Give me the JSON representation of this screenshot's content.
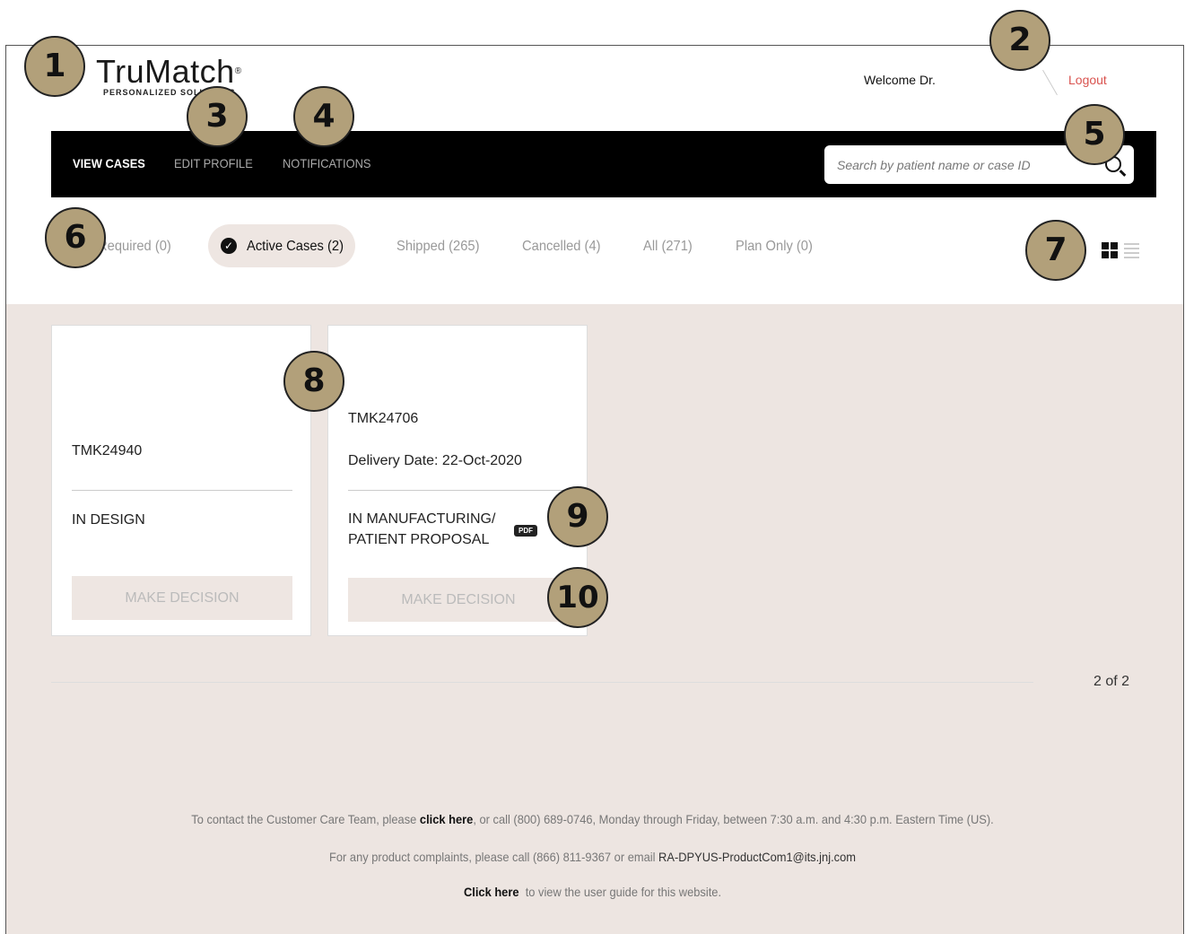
{
  "header": {
    "logo_word": "TruMatch",
    "logo_tag": "PERSONALIZED SOLUTIONS",
    "welcome": "Welcome Dr.",
    "logout": "Logout"
  },
  "nav": {
    "items": [
      "VIEW CASES",
      "EDIT PROFILE",
      "NOTIFICATIONS"
    ],
    "search_placeholder": "Search by patient name or case ID"
  },
  "filters": {
    "action_required": "Action Required (0)",
    "active": "Active Cases (2)",
    "shipped": "Shipped (265)",
    "cancelled": "Cancelled (4)",
    "all": "All (271)",
    "plan_only": "Plan Only (0)"
  },
  "cards": [
    {
      "case_id": "TMK24940",
      "status": "IN DESIGN",
      "button": "MAKE DECISION"
    },
    {
      "case_id": "TMK24706",
      "delivery": "Delivery Date: 22-Oct-2020",
      "status_line1": "IN MANUFACTURING/",
      "status_line2": "PATIENT PROPOSAL",
      "pdf": "PDF",
      "button": "MAKE DECISION"
    }
  ],
  "pager": "2 of 2",
  "footer": {
    "line1_pre": "To contact the Customer Care Team, please ",
    "line1_link": "click here",
    "line1_post": ", or call (800) 689-0746, Monday through Friday, between 7:30 a.m. and 4:30 p.m. Eastern Time (US).",
    "line2_pre": "For any product complaints, please call (866) 811-9367 or email ",
    "line2_email": "RA-DPYUS-ProductCom1@its.jnj.com",
    "line3_link": "Click here",
    "line3_post": "  to view the user guide for this website."
  },
  "callouts": [
    "1",
    "2",
    "3",
    "4",
    "5",
    "6",
    "7",
    "8",
    "9",
    "10"
  ],
  "colors": {
    "callout": "#b2a07a",
    "navbar": "#000000",
    "content_bg": "#ede5e1",
    "logout": "#d9534f"
  }
}
